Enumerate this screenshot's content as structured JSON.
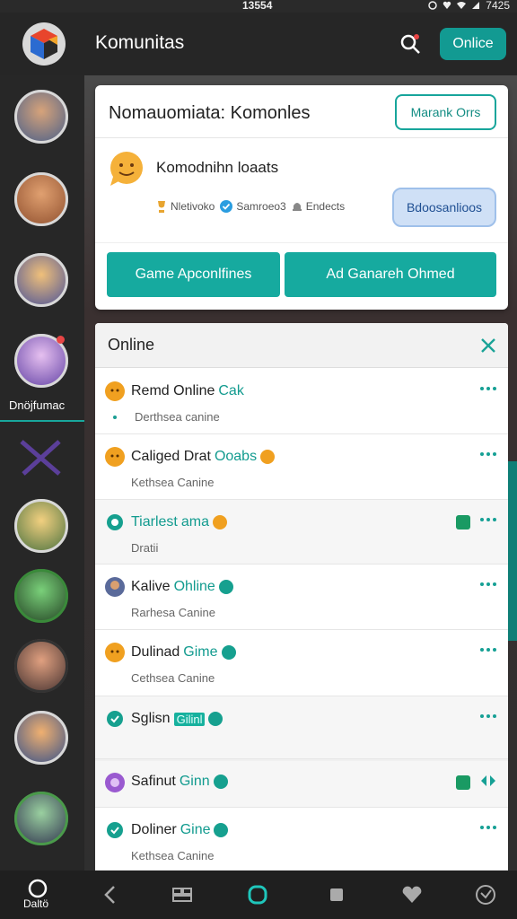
{
  "status_bar": {
    "time": "13554",
    "right_text": "7425"
  },
  "app_bar": {
    "title": "Komunitas",
    "online_button": "Onlice"
  },
  "sidebar": {
    "active_label": "Dnöjfumac"
  },
  "top_card": {
    "title": "Nomauomiata: Komonles",
    "manage_button": "Marank Orrs",
    "subtitle": "Komodnihn loaats",
    "stats": [
      "Nletivoko",
      "Samroeo3",
      "Endects"
    ],
    "pill_button": "Bdoosanlioos",
    "action_left": "Game Apconlfines",
    "action_right": "Ad Ganareh Ohmed"
  },
  "online_list": {
    "header": "Online",
    "rows": [
      {
        "name": "Remd Online",
        "tag": "Cak",
        "sub": "Derthsea canine"
      },
      {
        "name": "Caliged Drat",
        "tag": "Ooabs",
        "sub": "Kethsea Canine"
      },
      {
        "name": "Tiarlest",
        "tag": "ama",
        "sub": "Dratii"
      },
      {
        "name": "Kalive",
        "tag": "Ohline",
        "sub": "Rarhesa Canine"
      },
      {
        "name": "Dulinad",
        "tag": "Gime",
        "sub": "Cethsea Canine"
      },
      {
        "name": "Sglisn",
        "tag": "Gilinl",
        "sub": ""
      },
      {
        "name": "Safinut",
        "tag": "Ginn",
        "sub": ""
      },
      {
        "name": "Doliner",
        "tag": "Gine",
        "sub": "Kethsea Canine"
      }
    ]
  },
  "bottom_nav": {
    "home_label": "Daltö"
  },
  "colors": {
    "accent": "#16aa9f",
    "dark_bg": "#262626"
  }
}
